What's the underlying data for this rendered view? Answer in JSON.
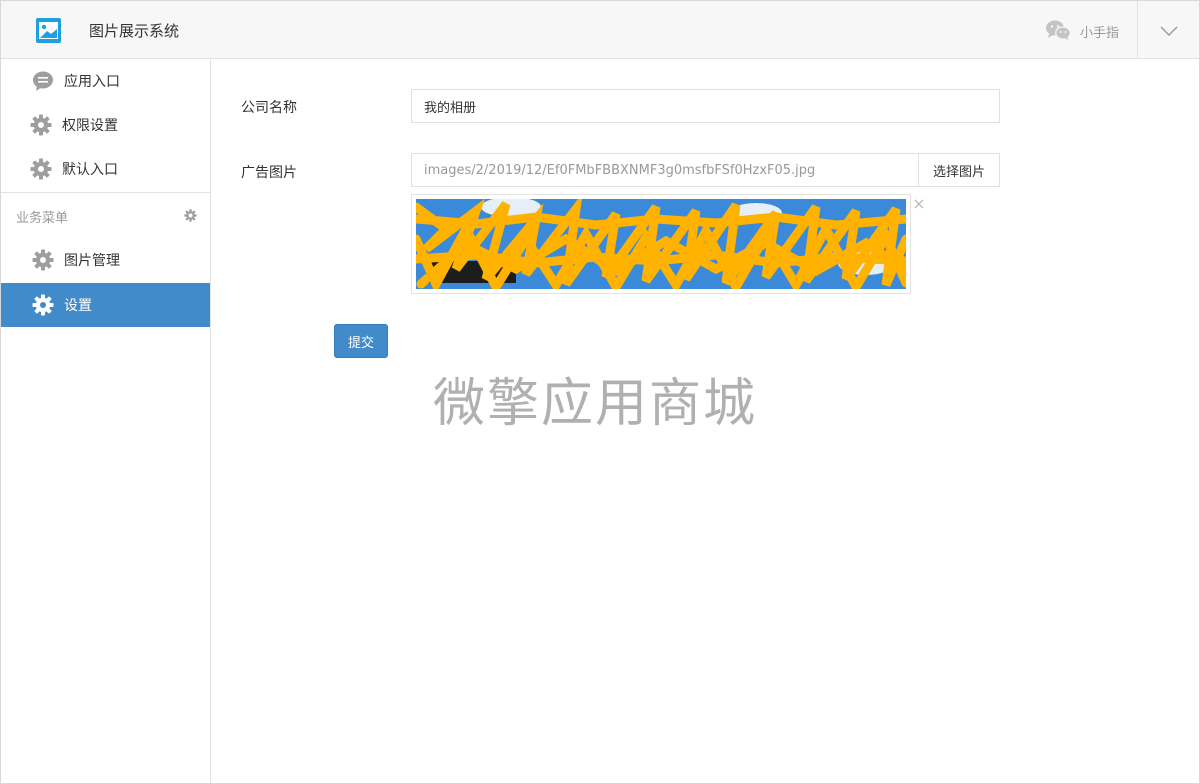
{
  "header": {
    "app_title": "图片展示系统",
    "logo_icon": "image-icon",
    "account_icon": "wechat-icon",
    "username": "小手指",
    "menu_icon": "chevron-down-icon"
  },
  "sidebar": {
    "items": [
      {
        "label": "应用入口",
        "icon": "chat-icon"
      },
      {
        "label": "权限设置",
        "icon": "gear-icon"
      },
      {
        "label": "默认入口",
        "icon": "gear-icon"
      }
    ],
    "section_title": "业务菜单",
    "section_icon": "gear-icon",
    "business_items": [
      {
        "label": "图片管理",
        "icon": "gear-icon"
      },
      {
        "label": "设置",
        "icon": "gear-icon",
        "active": true
      }
    ]
  },
  "form": {
    "company_label": "公司名称",
    "company_value": "我的相册",
    "ad_image_label": "广告图片",
    "ad_image_path": "images/2/2019/12/Ef0FMbFBBXNMF3g0msfbFSf0HzxF05.jpg",
    "choose_image_label": "选择图片",
    "remove_image_symbol": "×",
    "submit_label": "提交"
  },
  "watermark": "微擎应用商城",
  "colors": {
    "accent": "#428bca",
    "header_bg": "#f7f7f7",
    "border": "#e3e3e3",
    "muted_text": "#999999",
    "redaction": "#ffb300",
    "image_bg": "#3b8ad9"
  }
}
